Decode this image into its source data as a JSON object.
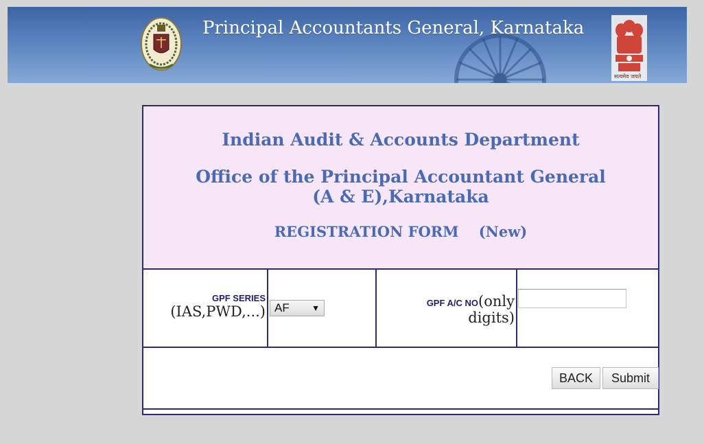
{
  "banner": {
    "title": "Principal Accountants General, Karnataka",
    "motto": "सत्यमेव जयते",
    "left_emblem_icon": "audit-department-emblem-icon",
    "right_emblem_icon": "national-emblem-icon",
    "background_icon": "ashoka-chakra-icon",
    "colors": {
      "banner_top": "#3c64a3",
      "banner_bottom": "#86a8d6"
    }
  },
  "header": {
    "department": "Indian Audit & Accounts Department",
    "office": "Office of the Principal Accountant General (A & E),Karnataka",
    "form_title": "REGISTRATION FORM    (New)",
    "colors": {
      "text": "#4a6bb3",
      "background": "#f7e6f8",
      "border": "#2b2a7a"
    }
  },
  "form": {
    "gpf_series": {
      "label": "GPF SERIES",
      "hint": "(IAS,PWD,...)",
      "selected": "AF"
    },
    "gpf_account": {
      "label": "GPF  A/C NO",
      "hint_line1": "(only",
      "hint_line2": "digits)",
      "value": "",
      "placeholder": ""
    },
    "buttons": {
      "back": "BACK",
      "submit": "Submit"
    }
  }
}
